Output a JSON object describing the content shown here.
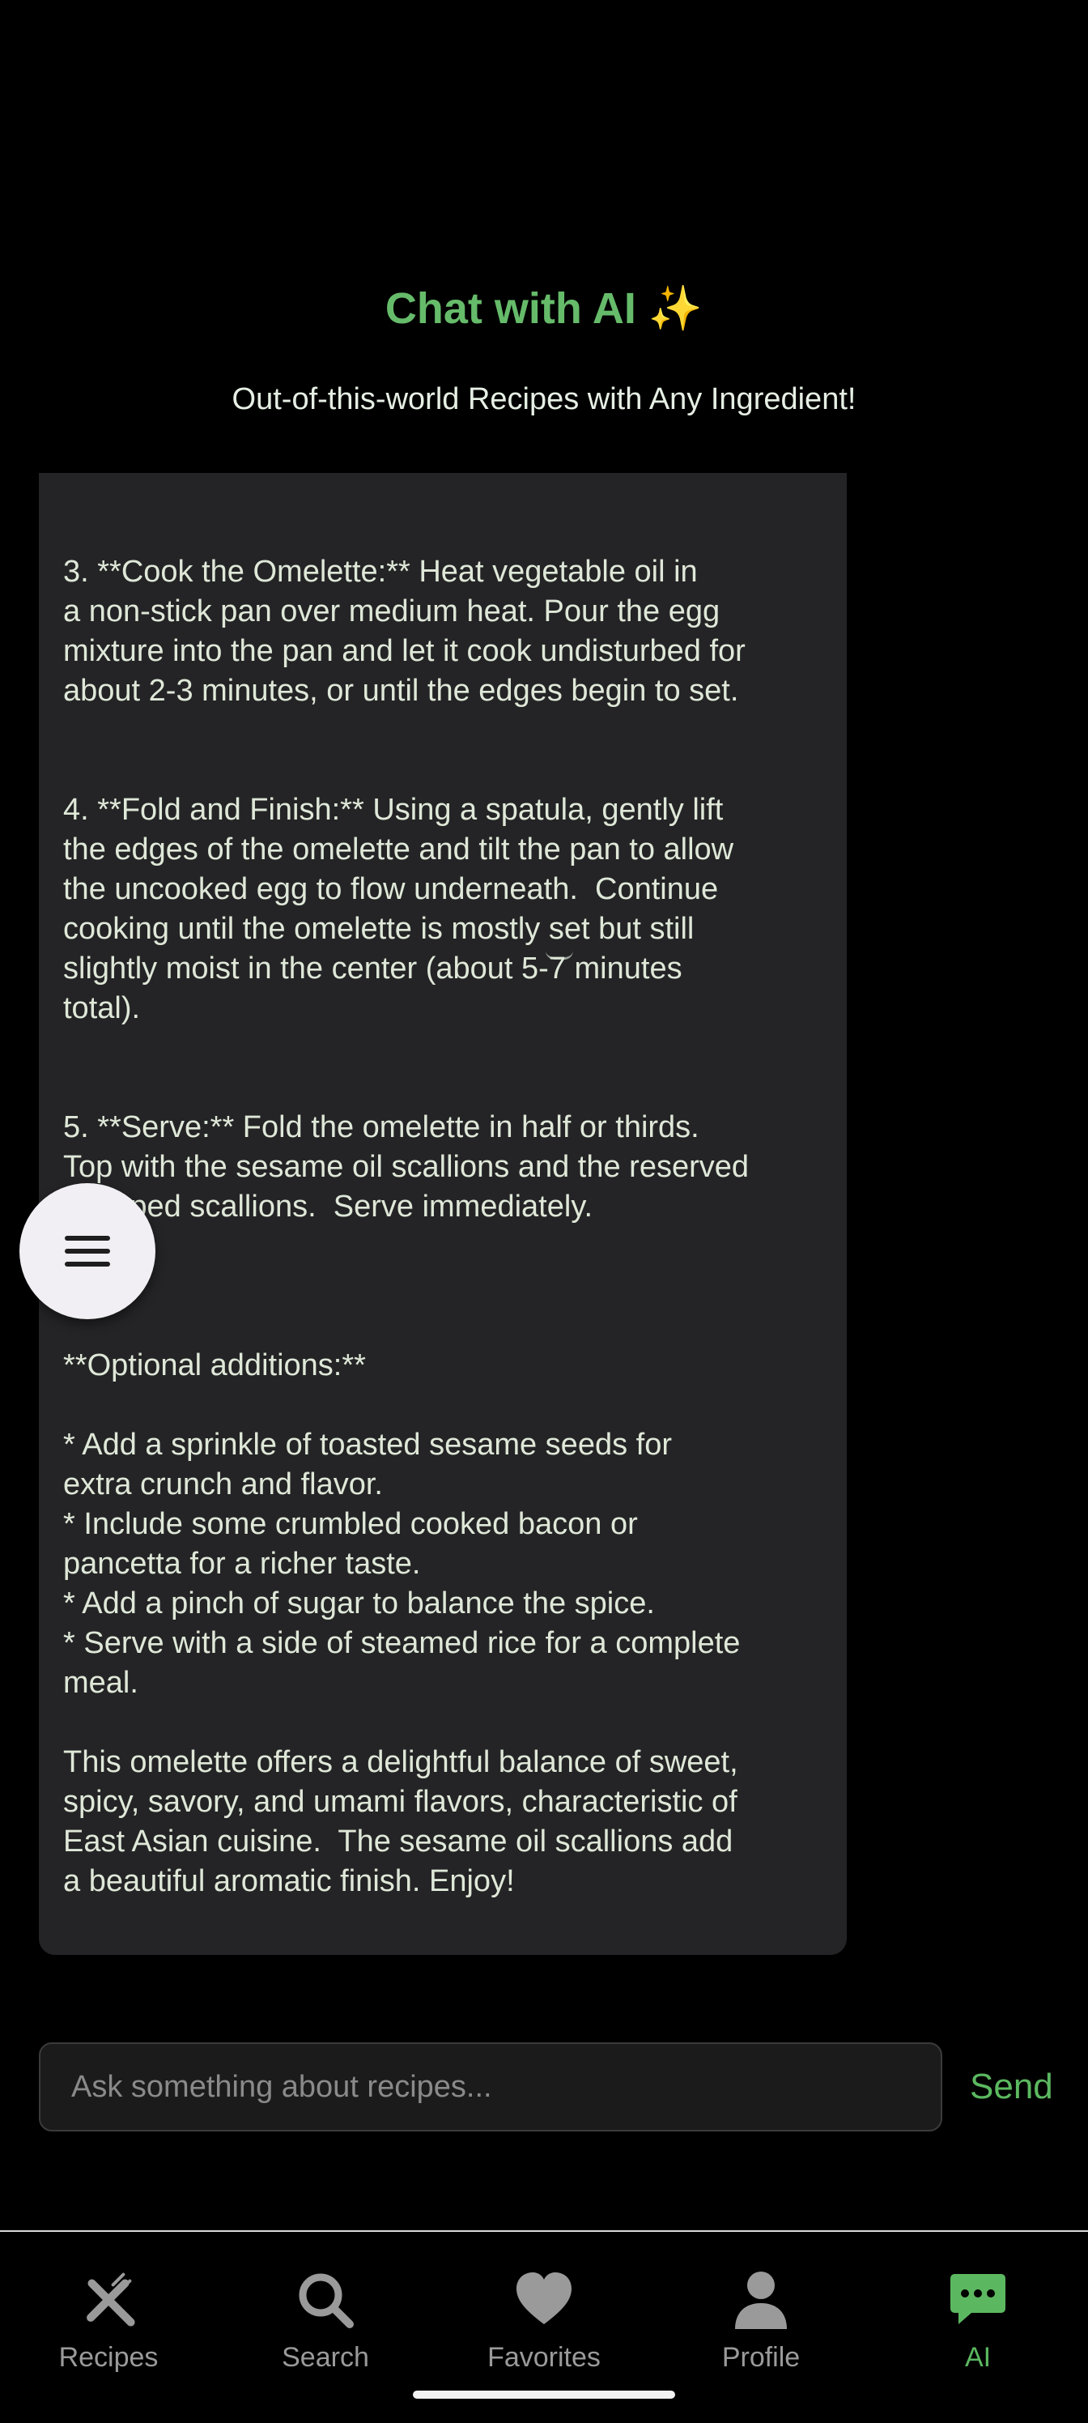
{
  "header": {
    "title": "Chat with AI ✨",
    "subtitle": "Out-of-this-world Recipes with Any Ingredient!"
  },
  "chat": {
    "message_paragraphs": [
      "3. **Cook the Omelette:** Heat vegetable oil in\na non-stick pan over medium heat. Pour the egg\nmixture into the pan and let it cook undisturbed for\nabout 2-3 minutes, or until the edges begin to set.",
      "4. **Fold and Finish:** Using a spatula, gently lift\nthe edges of the omelette and tilt the pan to allow\nthe uncooked egg to flow underneath.  Continue\ncooking until the omelette is mostly set but still\nslightly moist in the center (about 5-7 minutes\ntotal).",
      "5. **Serve:** Fold the omelette in half or thirds.\nTop with the sesame oil scallions and the reserved\nchopped scallions.  Serve immediately.",
      "**Optional additions:**",
      "* Add a sprinkle of toasted sesame seeds for\nextra crunch and flavor.\n* Include some crumbled cooked bacon or\npancetta for a richer taste.\n* Add a pinch of sugar to balance the spice.\n* Serve with a side of steamed rice for a complete\nmeal.",
      "This omelette offers a delightful balance of sweet,\nspicy, savory, and umami flavors, characteristic of\nEast Asian cuisine.  The sesame oil scallions add\na beautiful aromatic finish. Enjoy!"
    ]
  },
  "fab": {
    "icon": "menu-icon"
  },
  "input": {
    "placeholder": "Ask something about recipes...",
    "value": "",
    "send_label": "Send"
  },
  "nav": {
    "items": [
      {
        "label": "Recipes",
        "icon": "utensils-icon",
        "active": false
      },
      {
        "label": "Search",
        "icon": "search-icon",
        "active": false
      },
      {
        "label": "Favorites",
        "icon": "heart-icon",
        "active": false
      },
      {
        "label": "Profile",
        "icon": "user-icon",
        "active": false
      },
      {
        "label": "AI",
        "icon": "chat-icon",
        "active": true
      }
    ]
  },
  "colors": {
    "background": "#000000",
    "accent": "#5cb860",
    "title": "#66bb6a",
    "bubble": "#242426",
    "inactive_nav": "#9a9a9a"
  }
}
